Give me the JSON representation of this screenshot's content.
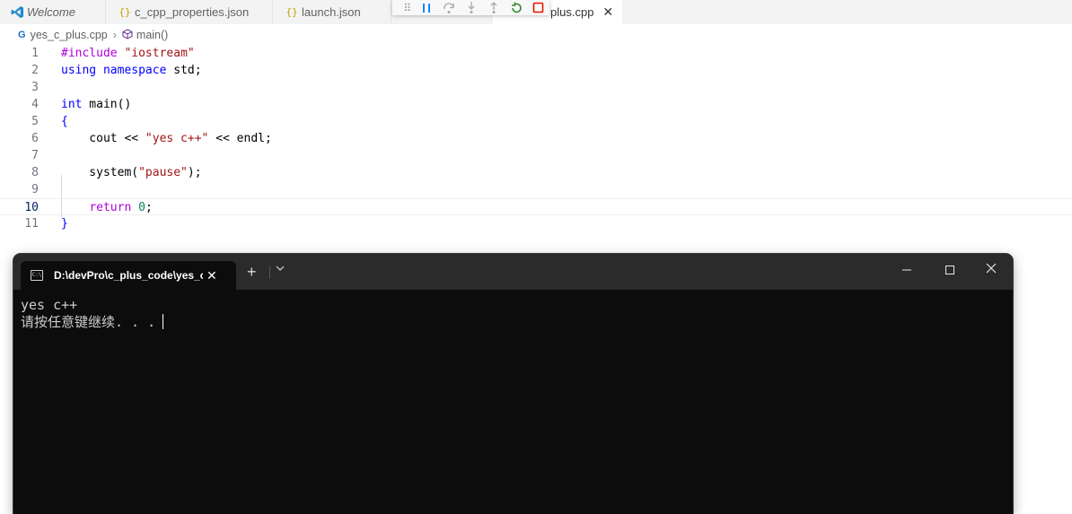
{
  "tabs": [
    {
      "label": "Welcome",
      "icon": "vscode-logo-icon"
    },
    {
      "label": "c_cpp_properties.json",
      "icon": "json-braces-icon"
    },
    {
      "label": "launch.json",
      "icon": "json-braces-icon"
    },
    {
      "label": "plus.cpp",
      "icon": "cpp-file-icon",
      "active": true
    }
  ],
  "json_icon_glyph": "{}",
  "breadcrumb": {
    "file": "yes_c_plus.cpp",
    "symbol": "main()"
  },
  "code_lines": [
    {
      "n": "1",
      "parts": [
        {
          "t": "#include ",
          "c": "pp"
        },
        {
          "t": "\"iostream\"",
          "c": "str"
        }
      ]
    },
    {
      "n": "2",
      "parts": [
        {
          "t": "using",
          "c": "kw"
        },
        {
          "t": " ",
          "c": ""
        },
        {
          "t": "namespace",
          "c": "kw"
        },
        {
          "t": " std;",
          "c": ""
        }
      ]
    },
    {
      "n": "3",
      "parts": []
    },
    {
      "n": "4",
      "parts": [
        {
          "t": "int",
          "c": "kw"
        },
        {
          "t": " main()",
          "c": ""
        }
      ]
    },
    {
      "n": "5",
      "parts": [
        {
          "t": "{",
          "c": "kw"
        }
      ]
    },
    {
      "n": "6",
      "parts": [
        {
          "t": "    cout << ",
          "c": ""
        },
        {
          "t": "\"yes c++\"",
          "c": "str"
        },
        {
          "t": " << endl;",
          "c": ""
        }
      ]
    },
    {
      "n": "7",
      "parts": []
    },
    {
      "n": "8",
      "parts": [
        {
          "t": "    system(",
          "c": ""
        },
        {
          "t": "\"pause\"",
          "c": "str"
        },
        {
          "t": ");",
          "c": ""
        }
      ]
    },
    {
      "n": "9",
      "parts": []
    },
    {
      "n": "10",
      "parts": [
        {
          "t": "    ",
          "c": ""
        },
        {
          "t": "return",
          "c": "ctl"
        },
        {
          "t": " ",
          "c": ""
        },
        {
          "t": "0",
          "c": "num"
        },
        {
          "t": ";",
          "c": ""
        }
      ],
      "current": true
    },
    {
      "n": "11",
      "parts": [
        {
          "t": "}",
          "c": "kw"
        }
      ]
    }
  ],
  "terminal": {
    "tab_title": "D:\\devPro\\c_plus_code\\yes_c_",
    "output": [
      "yes c++",
      "请按任意键继续. . ."
    ]
  },
  "colors": {
    "keyword": "#0000ff",
    "string": "#a31515",
    "number": "#098658",
    "preprocessor": "#af00db",
    "terminal_bg": "#0c0c0c"
  }
}
